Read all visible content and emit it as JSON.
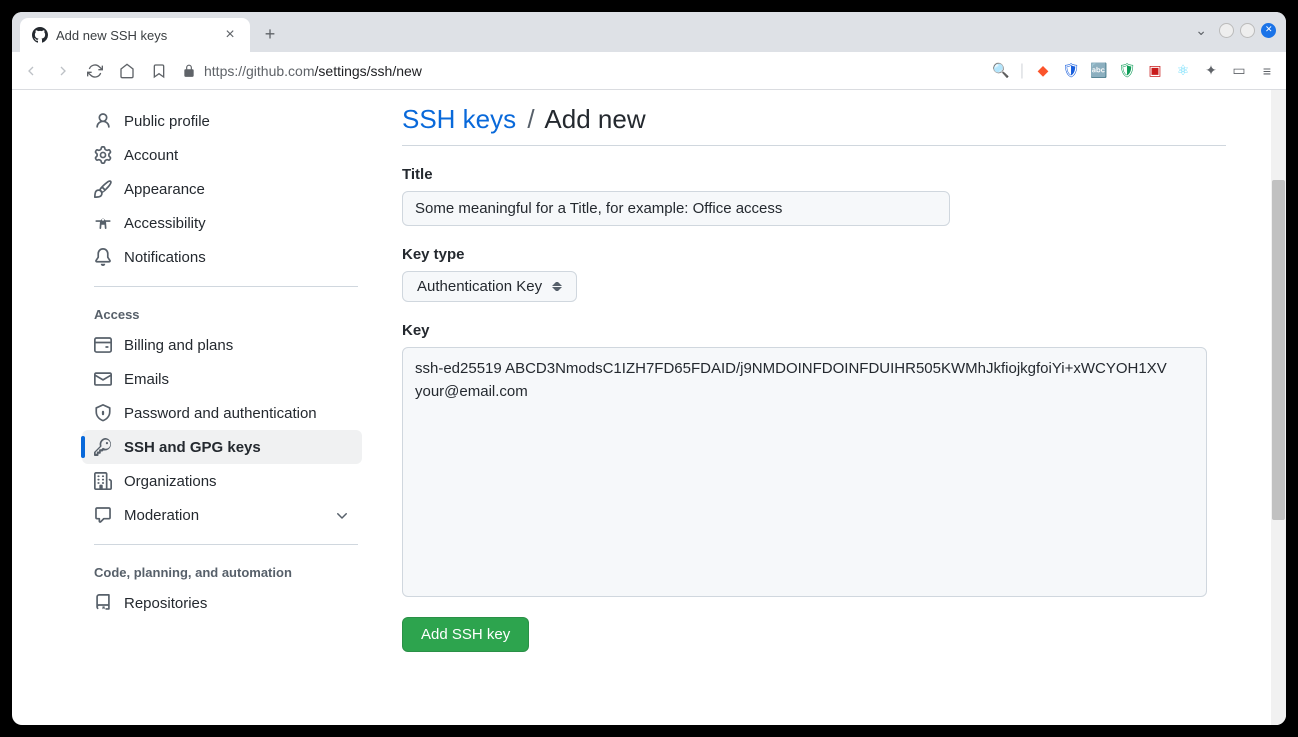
{
  "browser": {
    "tab_title": "Add new SSH keys",
    "url_host": "https://github.com",
    "url_path": "/settings/ssh/new"
  },
  "sidebar": {
    "items_top": [
      {
        "icon": "person",
        "label": "Public profile"
      },
      {
        "icon": "gear",
        "label": "Account"
      },
      {
        "icon": "paintbrush",
        "label": "Appearance"
      },
      {
        "icon": "accessibility",
        "label": "Accessibility"
      },
      {
        "icon": "bell",
        "label": "Notifications"
      }
    ],
    "heading_access": "Access",
    "items_access": [
      {
        "icon": "credit-card",
        "label": "Billing and plans"
      },
      {
        "icon": "mail",
        "label": "Emails"
      },
      {
        "icon": "shield-lock",
        "label": "Password and authentication"
      },
      {
        "icon": "key",
        "label": "SSH and GPG keys",
        "active": true
      },
      {
        "icon": "organization",
        "label": "Organizations"
      },
      {
        "icon": "comment",
        "label": "Moderation",
        "chevron": true
      }
    ],
    "heading_code": "Code, planning, and automation",
    "items_code": [
      {
        "icon": "repo",
        "label": "Repositories"
      }
    ]
  },
  "main": {
    "breadcrumb_link": "SSH keys",
    "breadcrumb_sep": "/",
    "breadcrumb_current": "Add new",
    "title_label": "Title",
    "title_value": "Some meaningful for a Title, for example: Office access",
    "keytype_label": "Key type",
    "keytype_value": "Authentication Key",
    "key_label": "Key",
    "key_value": "ssh-ed25519 ABCD3NmodsC1IZH7FD65FDAID/j9NMDOINFDOINFDUIHR505KWMhJkfiojkgfoiYi+xWCYOH1XV your@email.com",
    "submit_label": "Add SSH key"
  }
}
